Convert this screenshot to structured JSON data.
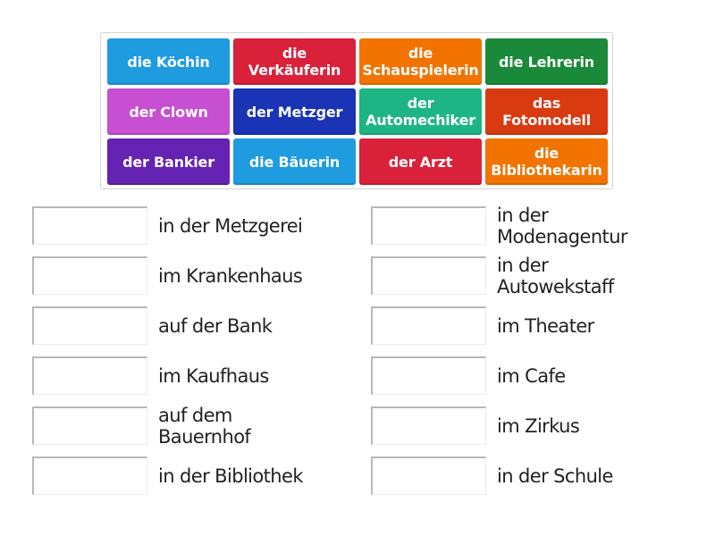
{
  "tiles": [
    {
      "label": "die Köchin",
      "color": "#1f9be0"
    },
    {
      "label": "die Verkäuferin",
      "color": "#d9213a"
    },
    {
      "label": "die Schauspielerin",
      "color": "#f27300"
    },
    {
      "label": "die Lehrerin",
      "color": "#1a8a3a"
    },
    {
      "label": "der Clown",
      "color": "#c74fd2"
    },
    {
      "label": "der Metzger",
      "color": "#1a34b5"
    },
    {
      "label": "der Automechiker",
      "color": "#1db583"
    },
    {
      "label": "das Fotomodell",
      "color": "#da3a10"
    },
    {
      "label": "der Bankier",
      "color": "#6423b3"
    },
    {
      "label": "die Bäuerin",
      "color": "#1f9be0"
    },
    {
      "label": "der Arzt",
      "color": "#d9213a"
    },
    {
      "label": "die Bibliothekarin",
      "color": "#f27300"
    }
  ],
  "targets_left": [
    {
      "label": "in der Metzgerei"
    },
    {
      "label": "im Krankenhaus"
    },
    {
      "label": "auf der Bank"
    },
    {
      "label": "im Kaufhaus"
    },
    {
      "label": "auf dem Bauernhof"
    },
    {
      "label": "in der Bibliothek"
    }
  ],
  "targets_right": [
    {
      "label": "in der Modenagentur"
    },
    {
      "label": "in der Autowekstaff"
    },
    {
      "label": "im Theater"
    },
    {
      "label": "im Cafe"
    },
    {
      "label": "im Zirkus"
    },
    {
      "label": "in der Schule"
    }
  ]
}
